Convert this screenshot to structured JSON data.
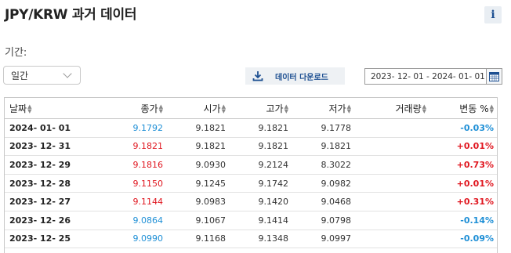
{
  "header": {
    "title": "JPY/KRW 과거 데이터",
    "info_label": "i"
  },
  "period": {
    "label": "기간:",
    "selected": "일간"
  },
  "download": {
    "label": "데이터 다운로드",
    "icon": "download-icon"
  },
  "date_range": {
    "value": "2023- 12- 01 - 2024- 01- 01",
    "icon": "calendar-icon"
  },
  "table": {
    "columns": [
      "날짜",
      "종가",
      "시가",
      "고가",
      "저가",
      "거래량",
      "변동 %"
    ],
    "rows": [
      {
        "date": "2024- 01- 01",
        "close": "9.1792",
        "open": "9.1821",
        "high": "9.1821",
        "low": "9.1778",
        "volume": "",
        "change": "-0.03%",
        "dir": "down"
      },
      {
        "date": "2023- 12- 31",
        "close": "9.1821",
        "open": "9.1821",
        "high": "9.1821",
        "low": "9.1821",
        "volume": "",
        "change": "+0.01%",
        "dir": "up"
      },
      {
        "date": "2023- 12- 29",
        "close": "9.1816",
        "open": "9.0930",
        "high": "9.2124",
        "low": "8.3022",
        "volume": "",
        "change": "+0.73%",
        "dir": "up"
      },
      {
        "date": "2023- 12- 28",
        "close": "9.1150",
        "open": "9.1245",
        "high": "9.1742",
        "low": "9.0982",
        "volume": "",
        "change": "+0.01%",
        "dir": "up"
      },
      {
        "date": "2023- 12- 27",
        "close": "9.1144",
        "open": "9.0983",
        "high": "9.1420",
        "low": "9.0468",
        "volume": "",
        "change": "+0.31%",
        "dir": "up"
      },
      {
        "date": "2023- 12- 26",
        "close": "9.0864",
        "open": "9.1067",
        "high": "9.1414",
        "low": "9.0798",
        "volume": "",
        "change": "-0.14%",
        "dir": "down"
      },
      {
        "date": "2023- 12- 25",
        "close": "9.0990",
        "open": "9.1168",
        "high": "9.1348",
        "low": "9.0997",
        "volume": "",
        "change": "-0.09%",
        "dir": "down"
      }
    ]
  },
  "colors": {
    "up": "#e0161f",
    "down": "#1e8fd6",
    "accent": "#1d4f91"
  }
}
